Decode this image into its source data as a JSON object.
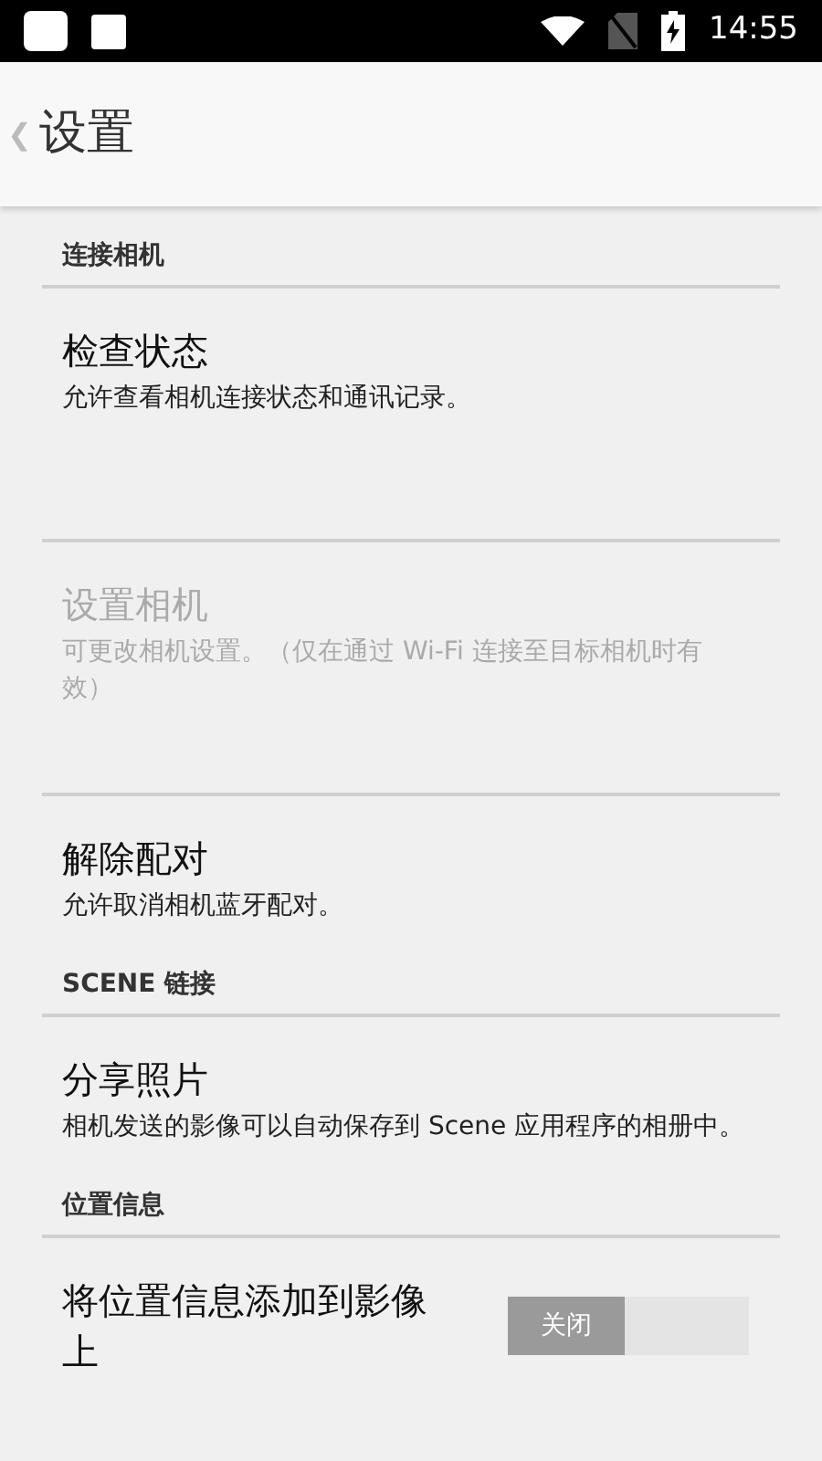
{
  "status_bar": {
    "time": "14:55"
  },
  "app_bar": {
    "back": "❮",
    "title": "设置"
  },
  "sections": [
    {
      "header": "连接相机",
      "items": [
        {
          "title": "检查状态",
          "description": "允许查看相机连接状态和通讯记录。",
          "disabled": false
        },
        {
          "title": "设置相机",
          "description": "可更改相机设置。（仅在通过 Wi-Fi 连接至目标相机时有效）",
          "disabled": true
        },
        {
          "title": "解除配对",
          "description": "允许取消相机蓝牙配对。",
          "disabled": false
        }
      ]
    },
    {
      "header": "SCENE 链接",
      "items": [
        {
          "title": "分享照片",
          "description": "相机发送的影像可以自动保存到 Scene 应用程序的相册中。",
          "disabled": false
        }
      ]
    },
    {
      "header": "位置信息",
      "items": [
        {
          "title": "将位置信息添加到影像上",
          "disabled": false,
          "kind": "toggle",
          "toggle": {
            "label": "关闭",
            "on": false
          }
        }
      ]
    }
  ]
}
